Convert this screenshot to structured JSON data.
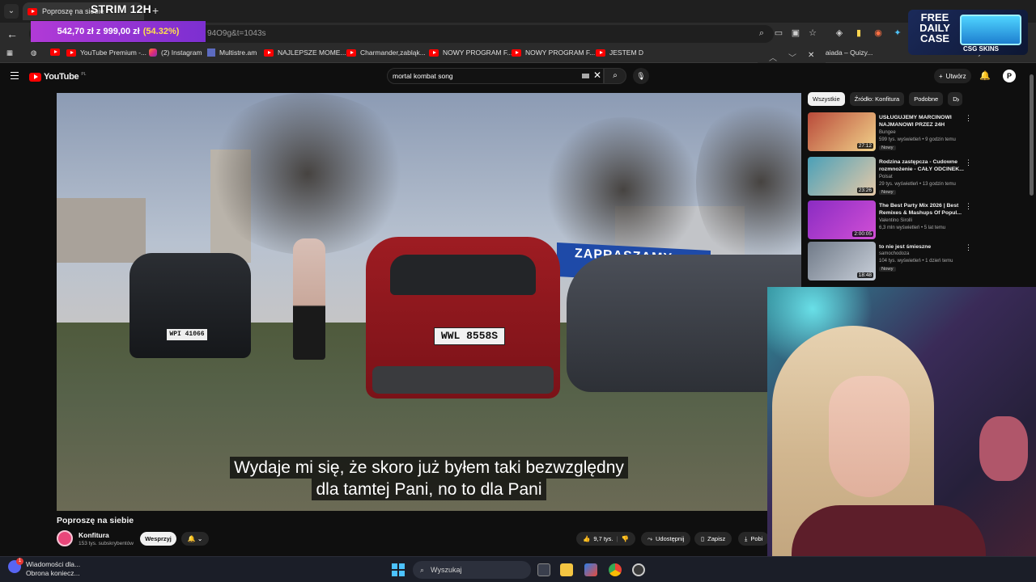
{
  "browser": {
    "tab_title": "Poproszę na siebie",
    "stream_overlay_title": "STRIM 12H",
    "url_fragment": "94O9g&t=1043s",
    "donation": {
      "amount": "542,70 zł z 999,00 zł",
      "percent": "(54.32%)"
    },
    "bookmarks": [
      "YouTube Premium -...",
      "(2) Instagram",
      "Multistre.am",
      "NAJLEPSZE MOME...",
      "Charmander,zabląk...",
      "NOWY PROGRAM F...",
      "NOWY PROGRAM F...",
      "JESTEM D",
      "iaiada – Quizy...",
      "Wszystkie zakładki"
    ]
  },
  "ad": {
    "title": "FREE DAILY CASE",
    "brand": "CSG SKINS"
  },
  "youtube": {
    "logo_text": "YouTube",
    "logo_region": "PL",
    "search": {
      "query": "mortal kombat song"
    },
    "create_label": "Utwórz",
    "avatar_letter": "P"
  },
  "video": {
    "subtitle_line1": "Wydaje mi się, że skoro już byłem taki bezwzględny",
    "subtitle_line2": "dla tamtej Pani, no to dla Pani",
    "plate_red": "WWL 8558S",
    "plate_black": "WPI 41066",
    "banner_text": "ZAPRASZAMY",
    "title": "Poproszę na siebie",
    "channel": {
      "name": "Konfitura",
      "subs": "153 tys. subskrybentów"
    },
    "support_label": "Wesprzyj",
    "likes": "9,7 tys.",
    "share_label": "Udostępnij",
    "save_label": "Zapisz",
    "download_label": "Pobi"
  },
  "chips": [
    "Wszystkie",
    "Źródło: Konfitura",
    "Podobne",
    "D"
  ],
  "recommendations": [
    {
      "title": "USŁUGUJEMY MARCINOWI NAJMANOWI PRZEZ 24H",
      "channel": "Bungee",
      "stats": "599 tys. wyświetleń • 9 godzin temu",
      "badge": "Nowy",
      "duration": "27:12",
      "color_a": "#b94a3a",
      "color_b": "#f1d28a"
    },
    {
      "title": "Rodzina zastępcza - Cudowne rozmnożenie - CAŁY ODCINEK...",
      "channel": "Polsat",
      "stats": "29 tys. wyświetleń • 13 godzin temu",
      "badge": "Nowy",
      "duration": "23:26",
      "color_a": "#4aa0b8",
      "color_b": "#e6c9a8"
    },
    {
      "title": "The Best Party Mix 2026 | Best Remixes & Mashups Of Popul...",
      "channel": "Valentino Sirolli",
      "stats": "6,3 mln wyświetleń • 5 lat temu",
      "badge": "",
      "duration": "2:00:05",
      "color_a": "#8a2cc2",
      "color_b": "#d24fd6"
    },
    {
      "title": "to nie jest śmieszne",
      "channel": "samochodoza",
      "stats": "104 tys. wyświetleń • 1 dzień temu",
      "badge": "Nowy",
      "duration": "18:48",
      "color_a": "#707a88",
      "color_b": "#c9d0da"
    }
  ],
  "taskbar": {
    "notification_title": "Wiadomości dla...",
    "notification_body": "Obrona koniecz...",
    "search_placeholder": "Wyszukaj"
  }
}
